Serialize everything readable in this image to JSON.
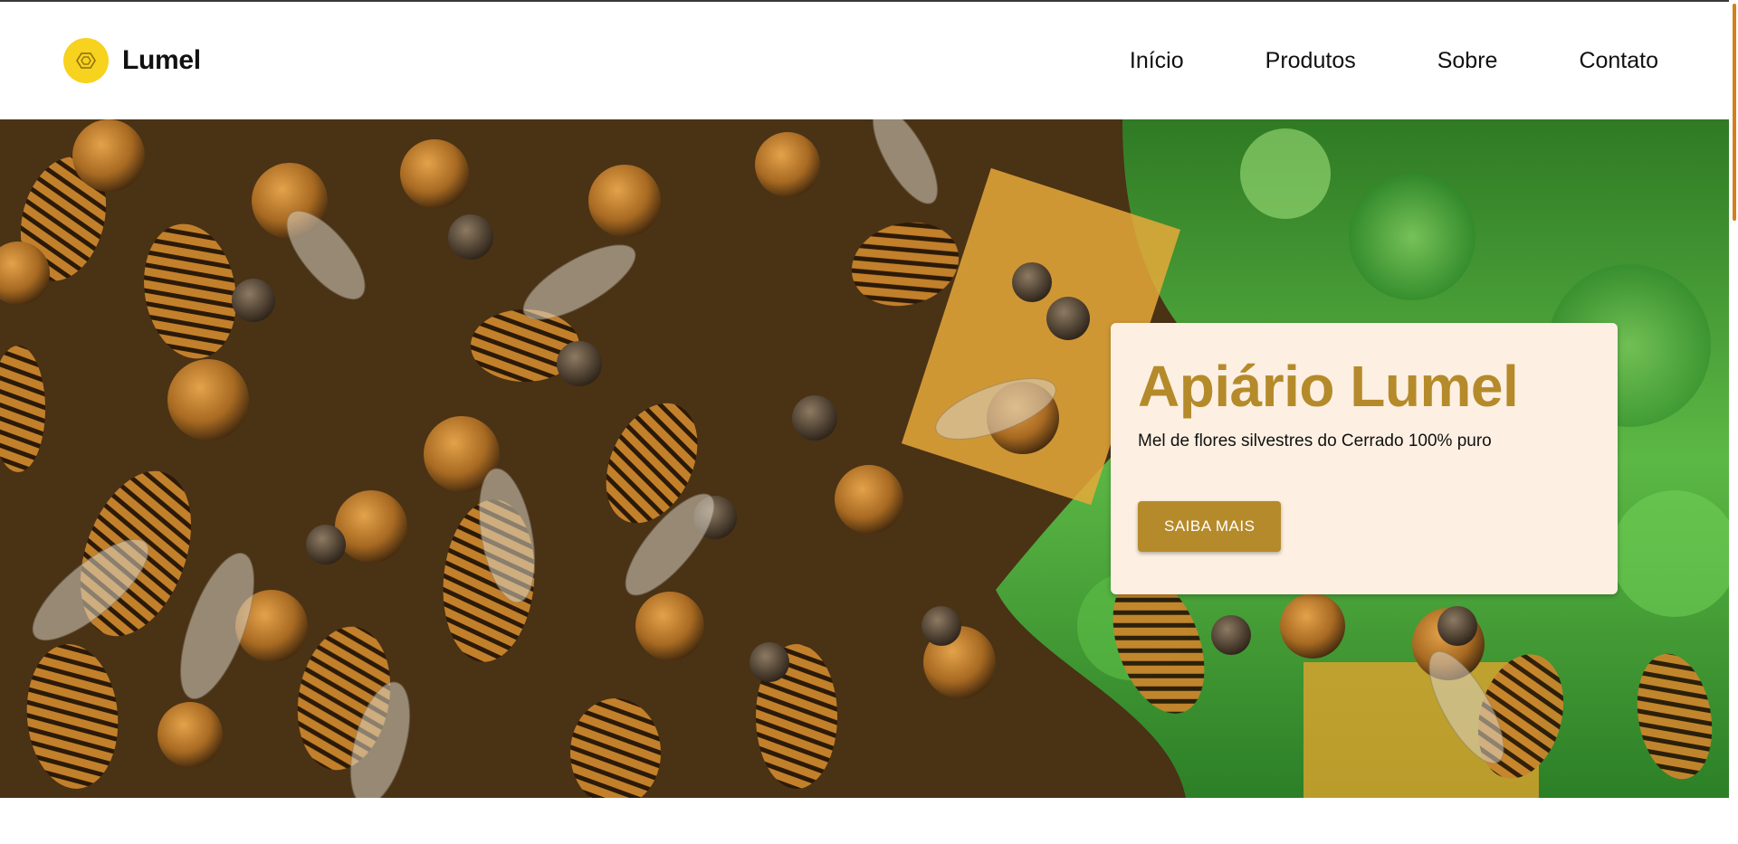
{
  "brand": {
    "name": "Lumel",
    "logo_icon": "hexagon-icon",
    "logo_color": "#f7d21e"
  },
  "nav": {
    "items": [
      {
        "label": "Início"
      },
      {
        "label": "Produtos"
      },
      {
        "label": "Sobre"
      },
      {
        "label": "Contato"
      }
    ]
  },
  "hero": {
    "image": "bees-on-honeycomb",
    "title": "Apiário Lumel",
    "subtitle": "Mel de flores silvestres do Cerrado 100% puro",
    "cta_label": "SAIBA MAIS",
    "accent_color": "#b58a2a",
    "card_background": "#fdf0e2"
  }
}
